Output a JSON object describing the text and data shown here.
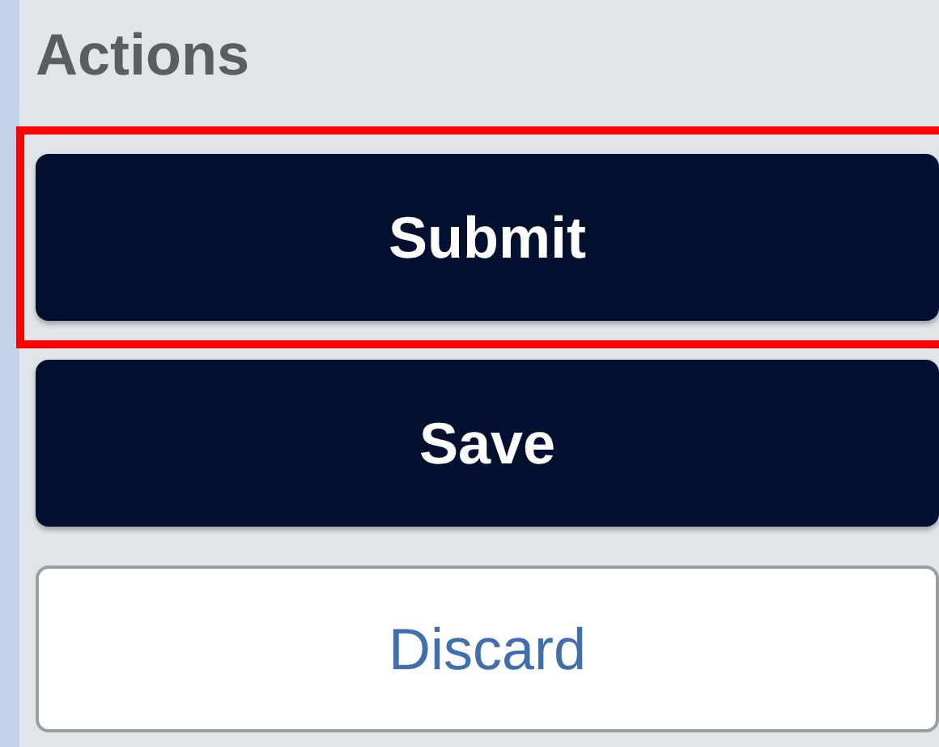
{
  "panel": {
    "title": "Actions"
  },
  "buttons": [
    {
      "label": "Submit",
      "kind": "primary",
      "highlighted": true
    },
    {
      "label": "Save",
      "kind": "primary",
      "highlighted": false
    },
    {
      "label": "Discard",
      "kind": "secondary",
      "highlighted": false
    }
  ]
}
